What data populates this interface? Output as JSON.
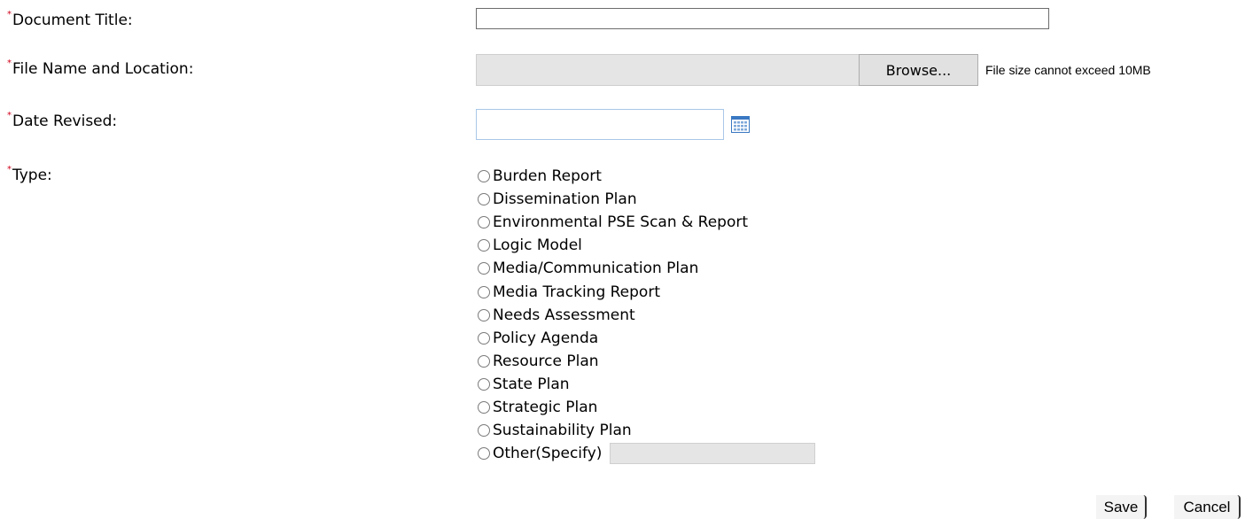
{
  "form": {
    "required_marker": "*",
    "document_title": {
      "label": "Document Title:",
      "value": ""
    },
    "file": {
      "label": "File Name and Location:",
      "path_value": "",
      "browse_label": "Browse...",
      "note": "File size cannot exceed 10MB"
    },
    "date_revised": {
      "label": "Date Revised:",
      "value": "",
      "calendar_icon": "calendar-icon"
    },
    "type": {
      "label": "Type:",
      "options": [
        "Burden Report",
        "Dissemination Plan",
        "Environmental PSE Scan & Report",
        "Logic Model",
        "Media/Communication Plan",
        "Media Tracking Report",
        "Needs Assessment",
        "Policy Agenda",
        "Resource Plan",
        "State Plan",
        "Strategic Plan",
        "Sustainability Plan",
        "Other(Specify)"
      ],
      "selected": null,
      "other_value": ""
    }
  },
  "actions": {
    "save_label": "Save",
    "cancel_label": "Cancel"
  },
  "colors": {
    "required_marker": "#d0021b",
    "readonly_field_bg": "#e5e5e5",
    "date_field_border": "#a9c7e8",
    "calendar_icon_blue": "#3a78c2"
  }
}
